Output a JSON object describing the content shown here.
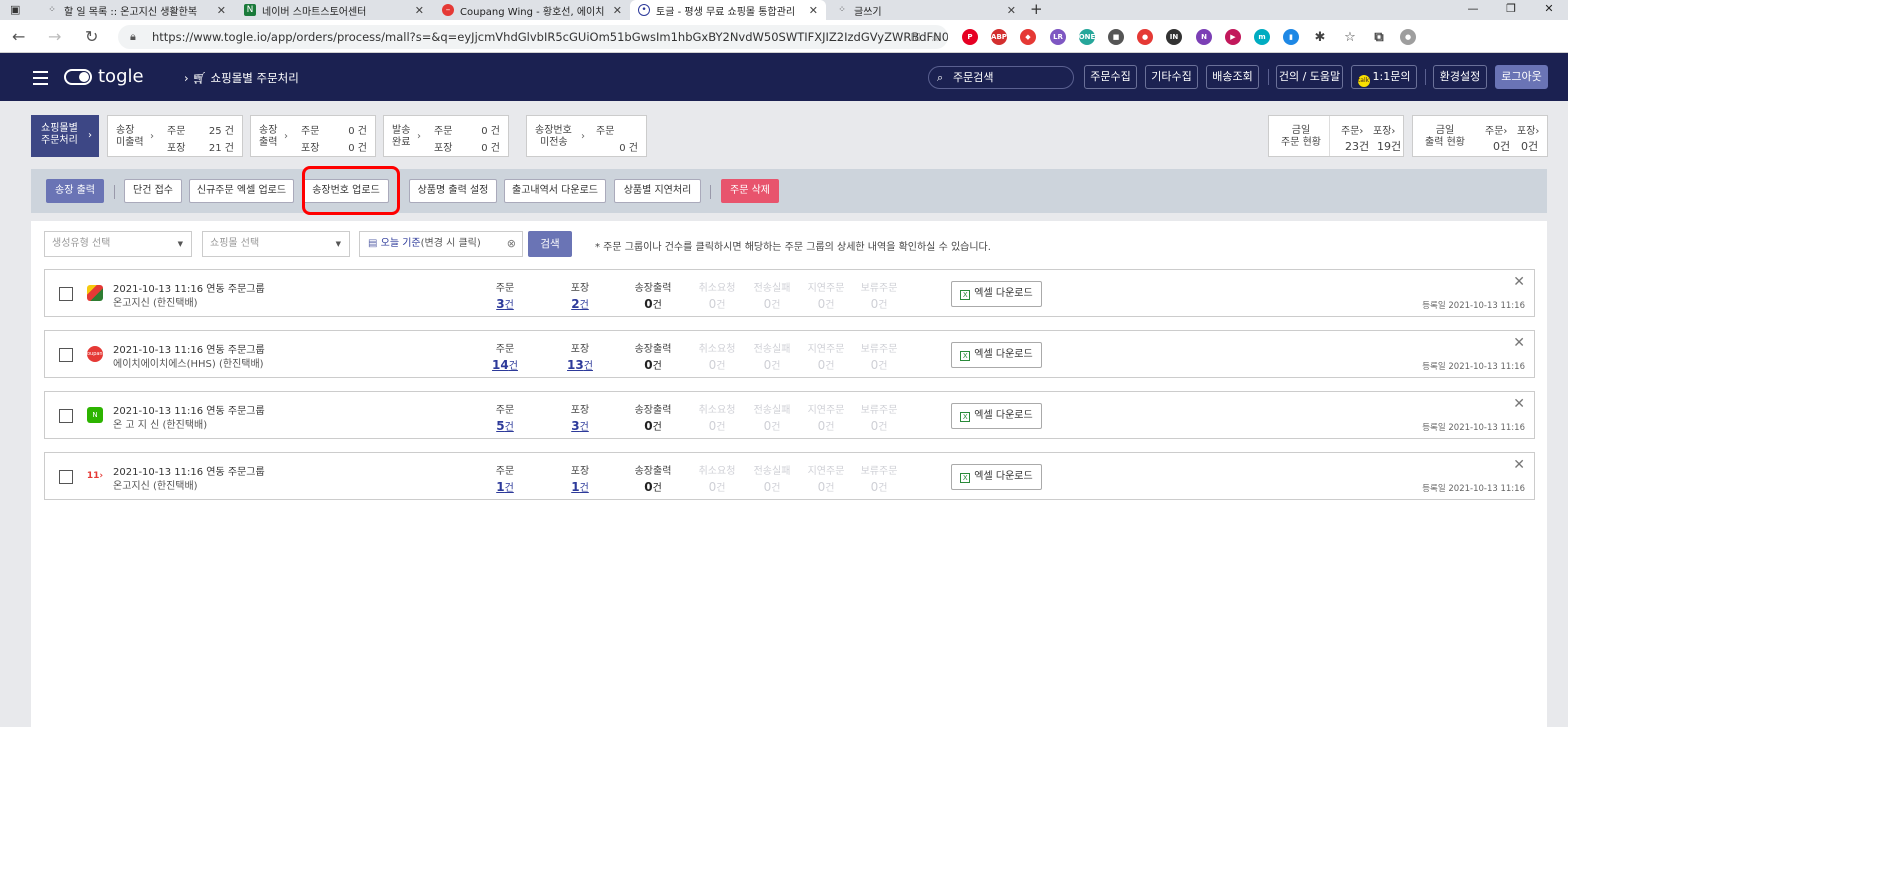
{
  "browser": {
    "tabs": [
      {
        "label": "할 일 목록 :: 온고지신 생활한복",
        "icon": "tt"
      },
      {
        "label": "네이버 스마트스토어센터",
        "icon": "N"
      },
      {
        "label": "Coupang Wing - 황호선, 에이치",
        "icon": "C"
      },
      {
        "label": "토글 - 평생 무료 쇼핑몰 통합관리",
        "icon": "t"
      },
      {
        "label": "글쓰기",
        "icon": "tt"
      }
    ],
    "url": "https://www.togle.io/app/orders/process/mall?s=&q=eyJjcmVhdGlvbIR5cGUiOm51bGwsIm1hbGxBY2NvdW50SWTIFXJIZ2IzdGVyZWRBdFN0Y...",
    "extensions": [
      {
        "name": "pinterest-extension-icon",
        "color": "#e60023",
        "label": "P"
      },
      {
        "name": "adblock-extension-icon",
        "color": "#d32f2f",
        "label": "ABP"
      },
      {
        "name": "shield-extension-icon",
        "color": "#e53935",
        "label": "◆"
      },
      {
        "name": "lr-extension-icon",
        "color": "#7e57c2",
        "label": "LR"
      },
      {
        "name": "one-extension-icon",
        "color": "#26a69a",
        "label": "ONE"
      },
      {
        "name": "capture-extension-icon",
        "color": "#555555",
        "label": "■"
      },
      {
        "name": "record-extension-icon",
        "color": "#e53935",
        "label": "●"
      },
      {
        "name": "lnn-extension-icon",
        "color": "#333333",
        "label": "IN"
      },
      {
        "name": "onenote-extension-icon",
        "color": "#7b3fb5",
        "label": "N"
      },
      {
        "name": "play-extension-icon",
        "color": "#c2185b",
        "label": "▶"
      },
      {
        "name": "m-extension-icon",
        "color": "#00acc1",
        "label": "m"
      },
      {
        "name": "sidebar-extension-icon",
        "color": "#1e88e5",
        "label": "▮"
      },
      {
        "name": "puzzle-extension-icon",
        "color": "#444444",
        "label": "✱"
      },
      {
        "name": "favorites-icon",
        "color": "#444444",
        "label": "☆"
      },
      {
        "name": "collections-icon",
        "color": "#444444",
        "label": "⧉"
      },
      {
        "name": "profile-avatar",
        "color": "#9e9e9e",
        "label": "●"
      }
    ]
  },
  "header": {
    "logo": "togle",
    "breadcrumb": "쇼핑몰별 주문처리",
    "search_label": "주문검색",
    "buttons": [
      "주문수집",
      "기타수집",
      "배송조회",
      "건의 / 도움말",
      "1:1문의",
      "환경설정",
      "로그아웃"
    ]
  },
  "status": {
    "main": [
      "쇼핑몰별",
      "주문처리"
    ],
    "boxes": [
      {
        "label": [
          "송장",
          "미출력"
        ],
        "rows": [
          [
            "주문",
            "25 건"
          ],
          [
            "포장",
            "21 건"
          ]
        ]
      },
      {
        "label": [
          "송장",
          "출력"
        ],
        "rows": [
          [
            "주문",
            "0 건"
          ],
          [
            "포장",
            "0 건"
          ]
        ]
      },
      {
        "label": [
          "발송",
          "완료"
        ],
        "rows": [
          [
            "주문",
            "0 건"
          ],
          [
            "포장",
            "0 건"
          ]
        ]
      },
      {
        "label": [
          "송장번호",
          "미전송"
        ],
        "rows": [
          [
            "주문",
            "0 건"
          ]
        ]
      }
    ],
    "today_order": {
      "label": [
        "금일",
        "주문 현황"
      ],
      "order_h": "주문",
      "order_v": "23건",
      "pack_h": "포장",
      "pack_v": "19건"
    },
    "today_ship": {
      "label": [
        "금일",
        "출력 현황"
      ],
      "order_h": "주문",
      "order_v": "0건",
      "pack_h": "포장",
      "pack_v": "0건"
    }
  },
  "toolbar": {
    "print": "송장 출력",
    "buttons": [
      "단건 접수",
      "신규주문 엑셀 업로드",
      "송장번호 업로드",
      "상품명 출력 설정",
      "출고내역서 다운로드",
      "상품별 지연처리"
    ],
    "delete": "주문 삭제"
  },
  "filters": {
    "type_placeholder": "생성유형 선택",
    "mall_placeholder": "쇼핑몰 선택",
    "date_label": "오늘 기준",
    "date_hint": "(변경 시 클릭)",
    "search_btn": "검색",
    "note": "* 주문 그룹이나 건수를 클릭하시면 해당하는 주문 그룹의 상세한 내역을 확인하실 수 있습니다."
  },
  "stat_headers": [
    "주문",
    "포장",
    "송장출력",
    "취소요청",
    "전송실패",
    "지연주문",
    "보류주문"
  ],
  "excel_label": "엑셀 다운로드",
  "order_groups": [
    {
      "title": "2021-10-13 11:16 연동 주문그룹",
      "mall": "온고지신 (한진택배)",
      "icon": "▦",
      "icon_color": "#3a3a3a",
      "values": [
        "3",
        "2",
        "0",
        "0",
        "0",
        "0",
        "0"
      ],
      "registered": "등록일 2021-10-13 11:16"
    },
    {
      "title": "2021-10-13 11:16 연동 주문그룹",
      "mall": "에이치에이치에스(HHS) (한진택배)",
      "icon": "coupang",
      "icon_color": "#e53935",
      "values": [
        "14",
        "13",
        "0",
        "0",
        "0",
        "0",
        "0"
      ],
      "registered": "등록일 2021-10-13 11:16"
    },
    {
      "title": "2021-10-13 11:16 연동 주문그룹",
      "mall": "온 고 지 신 (한진택배)",
      "icon": "N",
      "icon_color": "#2db400",
      "values": [
        "5",
        "3",
        "0",
        "0",
        "0",
        "0",
        "0"
      ],
      "registered": "등록일 2021-10-13 11:16"
    },
    {
      "title": "2021-10-13 11:16 연동 주문그룹",
      "mall": "온고지신 (한진택배)",
      "icon": "11",
      "icon_color": "#ffffff",
      "values": [
        "1",
        "1",
        "0",
        "0",
        "0",
        "0",
        "0"
      ],
      "registered": "등록일 2021-10-13 11:16"
    }
  ],
  "unit": "건",
  "colors": {
    "header_bg": "#1b2151",
    "accent": "#6a74b5",
    "danger": "#e8546d",
    "highlight": "#ff0000"
  }
}
